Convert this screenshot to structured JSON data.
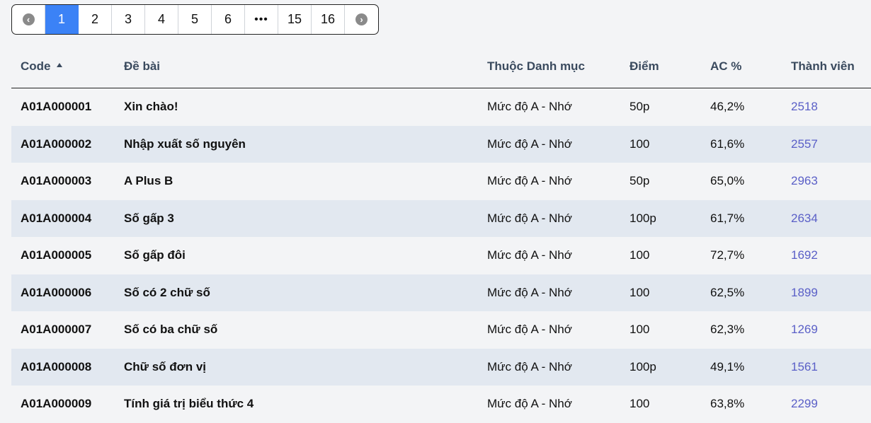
{
  "pagination": {
    "prev_icon": "‹",
    "next_icon": "›",
    "pages": [
      "1",
      "2",
      "3",
      "4",
      "5",
      "6",
      "•••",
      "15",
      "16"
    ],
    "active": "1"
  },
  "table": {
    "headers": {
      "code": "Code",
      "title": "Đề bài",
      "category": "Thuộc Danh mục",
      "points": "Điểm",
      "ac": "AC %",
      "members": "Thành viên"
    },
    "rows": [
      {
        "code": "A01A000001",
        "title": "Xin chào!",
        "category": "Mức độ A - Nhớ",
        "points": "50p",
        "ac": "46,2%",
        "members": "2518"
      },
      {
        "code": "A01A000002",
        "title": "Nhập xuất số nguyên",
        "category": "Mức độ A - Nhớ",
        "points": "100",
        "ac": "61,6%",
        "members": "2557"
      },
      {
        "code": "A01A000003",
        "title": "A Plus B",
        "category": "Mức độ A - Nhớ",
        "points": "50p",
        "ac": "65,0%",
        "members": "2963"
      },
      {
        "code": "A01A000004",
        "title": "Số gấp 3",
        "category": "Mức độ A - Nhớ",
        "points": "100p",
        "ac": "61,7%",
        "members": "2634"
      },
      {
        "code": "A01A000005",
        "title": "Số gấp đôi",
        "category": "Mức độ A - Nhớ",
        "points": "100",
        "ac": "72,7%",
        "members": "1692"
      },
      {
        "code": "A01A000006",
        "title": "Số có 2 chữ số",
        "category": "Mức độ A - Nhớ",
        "points": "100",
        "ac": "62,5%",
        "members": "1899"
      },
      {
        "code": "A01A000007",
        "title": "Số có ba chữ số",
        "category": "Mức độ A - Nhớ",
        "points": "100",
        "ac": "62,3%",
        "members": "1269"
      },
      {
        "code": "A01A000008",
        "title": "Chữ số đơn vị",
        "category": "Mức độ A - Nhớ",
        "points": "100p",
        "ac": "49,1%",
        "members": "1561"
      },
      {
        "code": "A01A000009",
        "title": "Tính giá trị biểu thức 4",
        "category": "Mức độ A - Nhớ",
        "points": "100",
        "ac": "63,8%",
        "members": "2299"
      }
    ]
  },
  "colors": {
    "accent": "#3b82f6",
    "link": "#5a5fc7",
    "row_alt": "#e2e8f0",
    "background": "#f3f4f6"
  }
}
